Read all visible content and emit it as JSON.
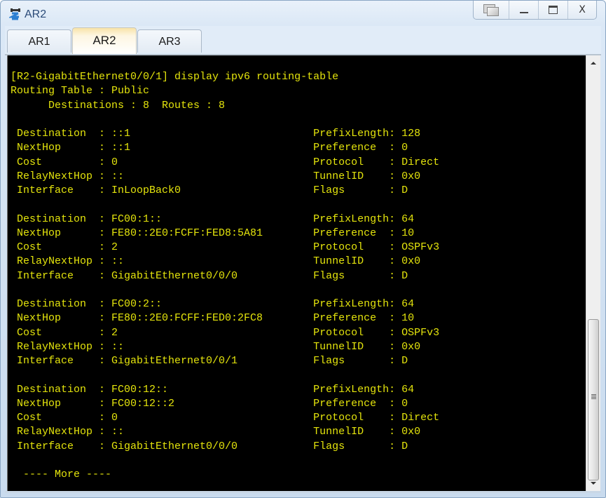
{
  "window": {
    "title": "AR2",
    "icon": "router-icon",
    "controls": {
      "restore": "restore-icon",
      "minimize": "minimize-icon",
      "maximize": "maximize-icon",
      "close": "X"
    }
  },
  "tabs": [
    {
      "label": "AR1",
      "active": false
    },
    {
      "label": "AR2",
      "active": true
    },
    {
      "label": "AR3",
      "active": false
    }
  ],
  "terminal": {
    "colors": {
      "background": "#000000",
      "foreground": "#e4e40c"
    },
    "prompt": "[R2-GigabitEthernet0/0/1]",
    "command": "display ipv6 routing-table",
    "table_name_label": "Routing Table",
    "table_name": "Public",
    "destinations": "8",
    "routes": "8",
    "entries": [
      {
        "Destination": "::1",
        "PrefixLength": "128",
        "NextHop": "::1",
        "Preference": "0",
        "Cost": "0",
        "Protocol": "Direct",
        "RelayNextHop": "::",
        "TunnelID": "0x0",
        "Interface": "InLoopBack0",
        "Flags": "D"
      },
      {
        "Destination": "FC00:1::",
        "PrefixLength": "64",
        "NextHop": "FE80::2E0:FCFF:FED8:5A81",
        "Preference": "10",
        "Cost": "2",
        "Protocol": "OSPFv3",
        "RelayNextHop": "::",
        "TunnelID": "0x0",
        "Interface": "GigabitEthernet0/0/0",
        "Flags": "D"
      },
      {
        "Destination": "FC00:2::",
        "PrefixLength": "64",
        "NextHop": "FE80::2E0:FCFF:FED0:2FC8",
        "Preference": "10",
        "Cost": "2",
        "Protocol": "OSPFv3",
        "RelayNextHop": "::",
        "TunnelID": "0x0",
        "Interface": "GigabitEthernet0/0/1",
        "Flags": "D"
      },
      {
        "Destination": "FC00:12::",
        "PrefixLength": "64",
        "NextHop": "FC00:12::2",
        "Preference": "0",
        "Cost": "0",
        "Protocol": "Direct",
        "RelayNextHop": "::",
        "TunnelID": "0x0",
        "Interface": "GigabitEthernet0/0/0",
        "Flags": "D"
      }
    ],
    "more_prompt": "  ---- More ----"
  },
  "scrollbar": {
    "position_fraction": 0.62,
    "visible_fraction": 0.38
  }
}
